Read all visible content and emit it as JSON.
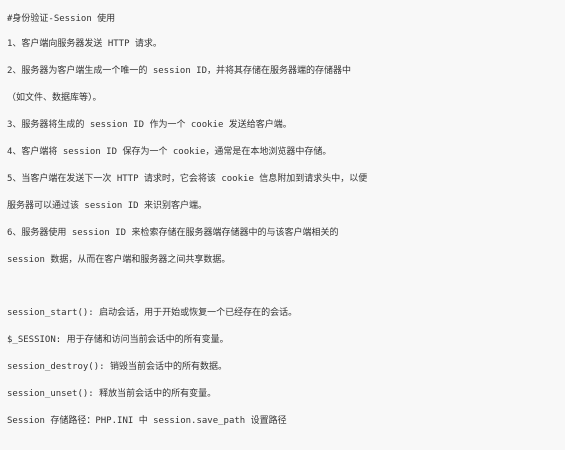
{
  "heading": "#身份验证-Session 使用",
  "steps": [
    "1、客户端向服务器发送 HTTP 请求。",
    "2、服务器为客户端生成一个唯一的 session ID，并将其存储在服务器端的存储器中",
    "（如文件、数据库等）。",
    "3、服务器将生成的 session ID 作为一个 cookie 发送给客户端。",
    "4、客户端将 session ID 保存为一个 cookie，通常是在本地浏览器中存储。",
    "5、当客户端在发送下一次 HTTP 请求时，它会将该 cookie 信息附加到请求头中，以便",
    "服务器可以通过该 session ID 来识别客户端。",
    "6、服务器使用 session ID 来检索存储在服务器端存储器中的与该客户端相关的",
    "session 数据，从而在客户端和服务器之间共享数据。"
  ],
  "functions": [
    "session_start(): 启动会话，用于开始或恢复一个已经存在的会话。",
    "$_SESSION: 用于存储和访问当前会话中的所有变量。",
    "session_destroy(): 销毁当前会话中的所有数据。",
    "session_unset(): 释放当前会话中的所有变量。",
    "Session 存储路径：PHP.INI 中 session.save_path 设置路径"
  ]
}
